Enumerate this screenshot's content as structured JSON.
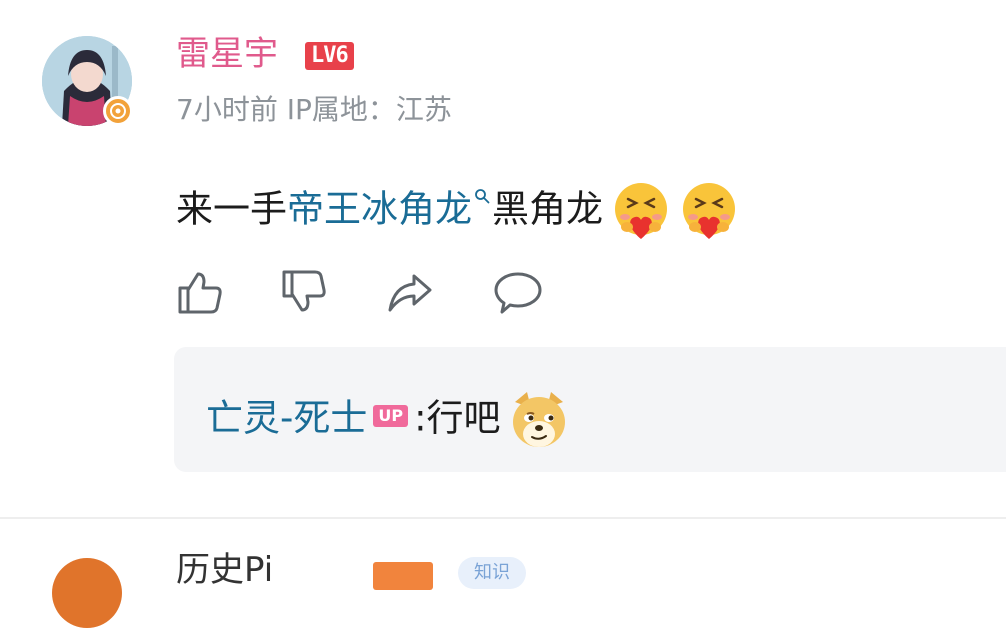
{
  "comment": {
    "username": "雷星宇",
    "level_badge": "LV6",
    "meta": "7小时前 IP属地：江苏",
    "text_prefix": "来一手",
    "link_text": "帝王冰角龙",
    "text_suffix": "黑角龙",
    "emojis": [
      "hugging-heart-emoji",
      "hugging-heart-emoji"
    ]
  },
  "actions": [
    "like-icon",
    "dislike-icon",
    "share-icon",
    "reply-icon"
  ],
  "reply": {
    "user": "亡灵-死士",
    "badge": "UP",
    "separator": ":",
    "text": "行吧",
    "emoji": "doge-emoji"
  },
  "next_comment": {
    "username_partial": "历史Pi",
    "tag_partial": "知识"
  },
  "colors": {
    "username": "#e05a8c",
    "link": "#1a6c96",
    "level_badge": "#e8414a",
    "up_badge": "#f06a9b"
  }
}
